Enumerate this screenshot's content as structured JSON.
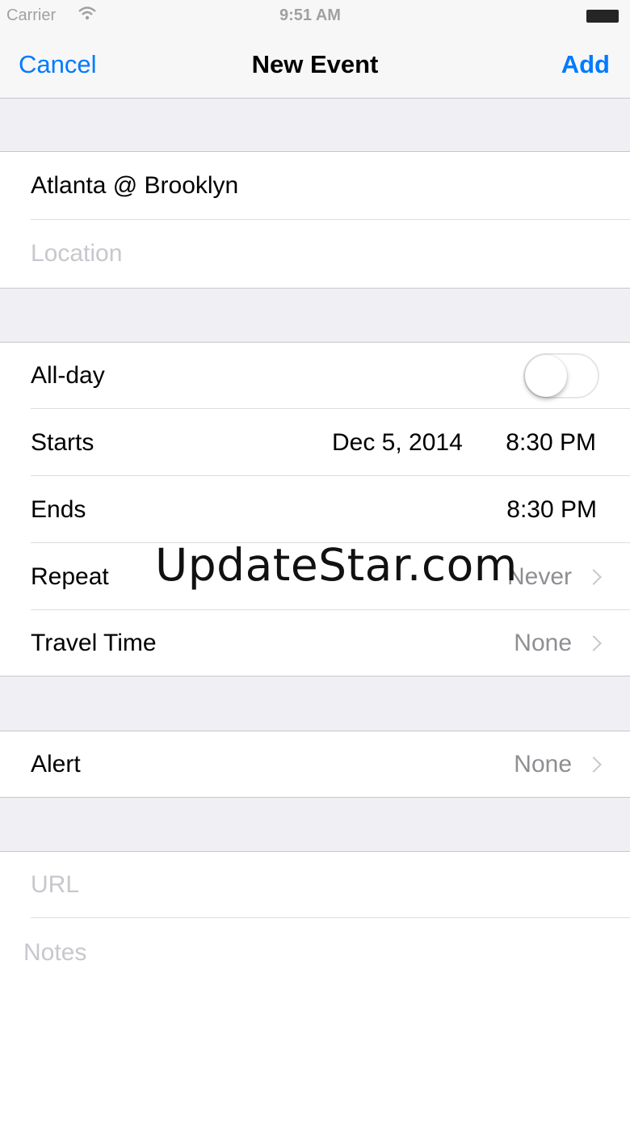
{
  "status_bar": {
    "carrier": "Carrier",
    "time": "9:51 AM"
  },
  "nav": {
    "cancel_label": "Cancel",
    "title": "New Event",
    "add_label": "Add",
    "accent_color": "#007aff"
  },
  "event": {
    "title_value": "Atlanta @ Brooklyn",
    "location_placeholder": "Location"
  },
  "timing": {
    "allday_label": "All-day",
    "allday_on": false,
    "starts_label": "Starts",
    "starts_date": "Dec 5, 2014",
    "starts_time": "8:30 PM",
    "ends_label": "Ends",
    "ends_time": "8:30 PM",
    "repeat_label": "Repeat",
    "repeat_value": "Never",
    "travel_label": "Travel Time",
    "travel_value": "None"
  },
  "alert": {
    "label": "Alert",
    "value": "None"
  },
  "extra": {
    "url_placeholder": "URL",
    "notes_placeholder": "Notes"
  },
  "watermark": "UpdateStar.com"
}
